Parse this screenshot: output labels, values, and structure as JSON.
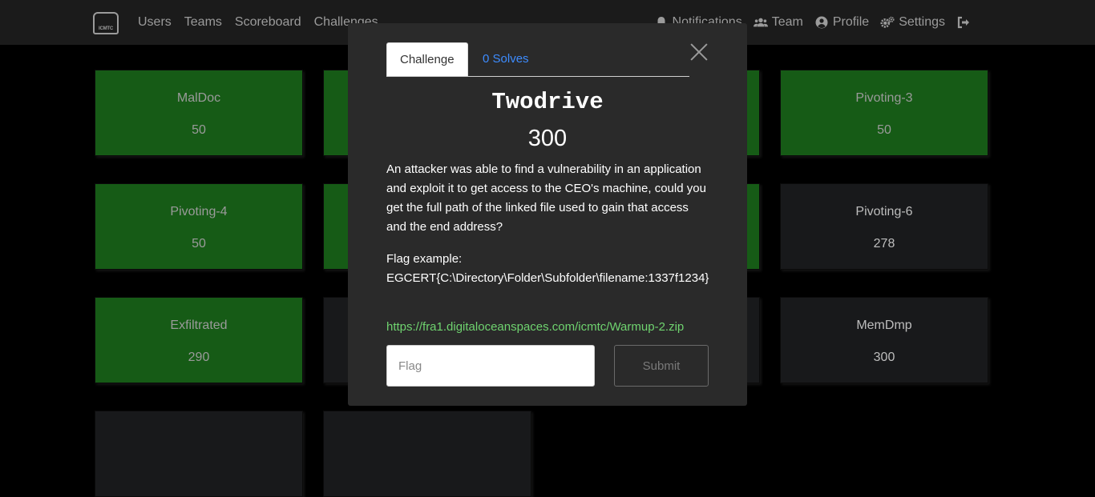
{
  "navbar": {
    "logo_text": "ICMTC",
    "left_links": [
      "Users",
      "Teams",
      "Scoreboard",
      "Challenges"
    ],
    "right_links": [
      {
        "label": "Notifications",
        "icon": "bell-icon"
      },
      {
        "label": "Team",
        "icon": "users-icon"
      },
      {
        "label": "Profile",
        "icon": "user-circle-icon"
      },
      {
        "label": "Settings",
        "icon": "cogs-icon"
      },
      {
        "label": "",
        "icon": "logout-icon"
      }
    ]
  },
  "tiles": [
    {
      "name": "MalDoc",
      "value": "50",
      "status": "solved"
    },
    {
      "name": "Pivoting-3",
      "value": "50",
      "status": "solved"
    },
    {
      "name": "Pivoting-4",
      "value": "50",
      "status": "solved"
    },
    {
      "name": "Pivoting-6",
      "value": "278",
      "status": "unsolved"
    },
    {
      "name": "Exfiltrated",
      "value": "290",
      "status": "solved"
    },
    {
      "name": "MemDmp",
      "value": "300",
      "status": "unsolved"
    }
  ],
  "modal": {
    "tabs": [
      "Challenge",
      "0 Solves"
    ],
    "title": "Twodrive",
    "value": "300",
    "description": "An attacker was able to find a vulnerability in an application and exploit it to get access to the CEO's machine, could you get the full path of the linked file used to gain that access and the end address?",
    "flag_example_label": "Flag example:",
    "flag_example_value": "EGCERT{C:\\Directory\\Folder\\Subfolder\\filename:1337f1234}",
    "link": "https://fra1.digitaloceanspaces.com/icmtc/Warmup-2.zip",
    "flag_placeholder": "Flag",
    "submit_label": "Submit"
  },
  "colors": {
    "solved": "#165b16",
    "unsolved": "#18191b",
    "link": "#6fd36f",
    "tab_link": "#3d8cff"
  }
}
